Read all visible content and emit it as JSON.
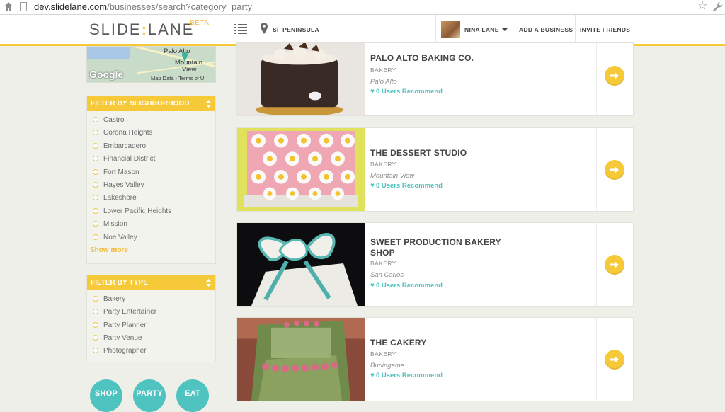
{
  "browser": {
    "url_host": "dev.slidelane.com",
    "url_path": "/businesses/search?category=party"
  },
  "header": {
    "logo_left": "SLIDE",
    "logo_sep": ":",
    "logo_right": "LANE",
    "logo_badge": "BETA",
    "location": "SF PENINSULA",
    "user_name": "NINA LANE",
    "add_business": "ADD A BUSINESS",
    "invite_friends": "INVITE FRIENDS"
  },
  "map": {
    "label_palo_alto": "Palo Alto",
    "label_mountain": "Mountain",
    "label_view": "View",
    "brand": "Google",
    "map_data": "Map Data",
    "terms": "Terms of U"
  },
  "neighborhood_filter": {
    "title": "FILTER BY NEIGHBORHOOD",
    "options": [
      "Castro",
      "Corona Heights",
      "Embarcadero",
      "Financial District",
      "Fort Mason",
      "Hayes Valley",
      "Lakeshore",
      "Lower Pacific Heights",
      "Mission",
      "Noe Valley"
    ],
    "show_more": "Show more"
  },
  "type_filter": {
    "title": "FILTER BY TYPE",
    "options": [
      "Bakery",
      "Party Entertainer",
      "Party Planner",
      "Party Venue",
      "Photographer"
    ]
  },
  "nav_buttons": [
    "SHOP",
    "PARTY",
    "EAT"
  ],
  "listings": [
    {
      "name": "PALO ALTO BAKING CO.",
      "category": "BAKERY",
      "city": "Palo Alto",
      "recommend": "0 Users Recommend"
    },
    {
      "name": "THE DESSERT STUDIO",
      "category": "BAKERY",
      "city": "Mountain View",
      "recommend": "0 Users Recommend"
    },
    {
      "name": "SWEET PRODUCTION BAKERY SHOP",
      "category": "BAKERY",
      "city": "San Carlos",
      "recommend": "0 Users Recommend"
    },
    {
      "name": "THE CAKERY",
      "category": "BAKERY",
      "city": "Burlingame",
      "recommend": "0 Users Recommend"
    }
  ],
  "colors": {
    "accent_yellow": "#f5c938",
    "teal": "#4ec3bf",
    "background": "#efefe9"
  }
}
